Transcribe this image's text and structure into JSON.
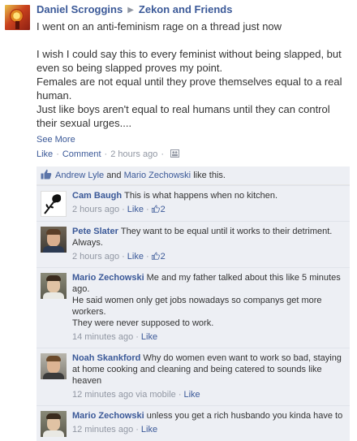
{
  "post": {
    "author": "Daniel Scroggins",
    "target": "Zekon and Friends",
    "arrow": "▶",
    "paragraphs": [
      "I went on an anti-feminism rage on a thread just now",
      "",
      "I wish I could say this to every feminist without being slapped, but even so being slapped proves my point.",
      "Females are not equal until they prove themselves equal to a real human.",
      "Just like boys aren't equal to real humans until they can control their sexual urges...."
    ],
    "see_more": "See More",
    "actions": {
      "like": "Like",
      "comment": "Comment",
      "time": "2 hours ago",
      "sep": "·"
    }
  },
  "likes": {
    "user1": "Andrew Lyle",
    "and": "and",
    "user2": "Mario Zechowski",
    "suffix": "like this."
  },
  "comments": [
    {
      "author": "Cam Baugh",
      "text": "This is what happens when no kitchen.",
      "time": "2 hours ago",
      "like": "Like",
      "likes": "2",
      "via": ""
    },
    {
      "author": "Pete Slater",
      "text": "They want to be equal until it works to their detriment. Always.",
      "time": "2 hours ago",
      "like": "Like",
      "likes": "2",
      "via": ""
    },
    {
      "author": "Mario Zechowski",
      "text_lines": [
        "Me and my father talked about this like 5 minutes ago.",
        "He said women only get jobs nowadays so companys get more workers.",
        "They were never supposed to work."
      ],
      "time": "14 minutes ago",
      "like": "Like",
      "likes": "",
      "via": ""
    },
    {
      "author": "Noah Skankford",
      "text": "Why do women even want to work so bad, staying at home cooking and cleaning and being catered to sounds like heaven",
      "time": "12 minutes ago",
      "via": "via mobile",
      "like": "Like",
      "likes": ""
    },
    {
      "author": "Mario Zechowski",
      "text": "unless you get a rich husbando you kinda have to",
      "time": "12 minutes ago",
      "like": "Like",
      "likes": "",
      "via": ""
    }
  ],
  "colors": {
    "link": "#3b5998",
    "meta": "#9197a3",
    "ufi_bg": "#edeff4"
  },
  "icons": {
    "audience": "friends-icon",
    "like": "thumbs-up-icon"
  }
}
